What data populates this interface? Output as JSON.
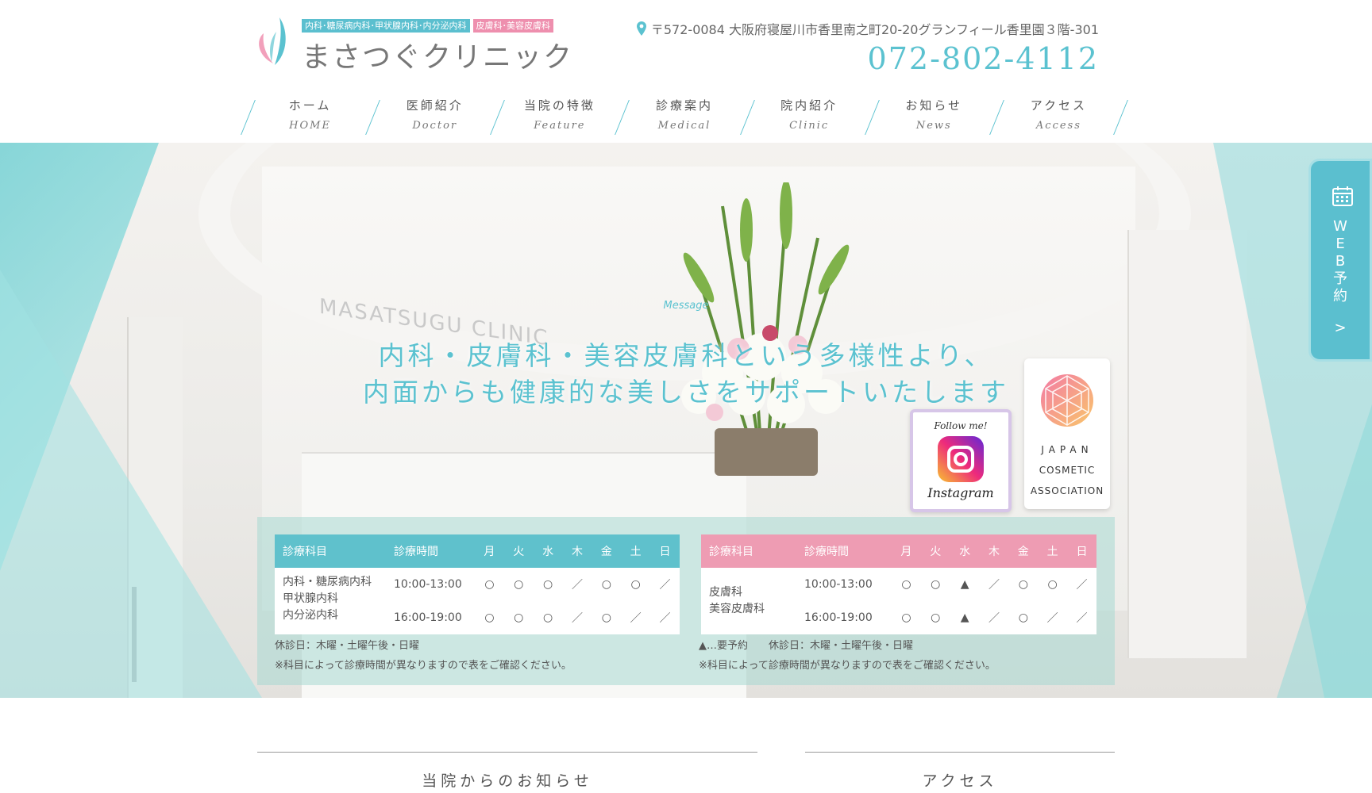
{
  "logo": {
    "tag_internal": "内科･糖尿病内科･甲状腺内科･内分泌内科",
    "tag_derm": "皮膚科･美容皮膚科",
    "name": "まさつぐクリニック"
  },
  "header": {
    "address": "〒572-0084 大阪府寝屋川市香里南之町20-20グランフィール香里園３階-301",
    "phone": "072-802-4112"
  },
  "nav": [
    {
      "jp": "ホーム",
      "en": "HOME"
    },
    {
      "jp": "医師紹介",
      "en": "Doctor"
    },
    {
      "jp": "当院の特徴",
      "en": "Feature"
    },
    {
      "jp": "診療案内",
      "en": "Medical"
    },
    {
      "jp": "院内紹介",
      "en": "Clinic"
    },
    {
      "jp": "お知らせ",
      "en": "News"
    },
    {
      "jp": "アクセス",
      "en": "Access"
    }
  ],
  "hero": {
    "wall_text": "MASATSUGU CLINIC",
    "message_label": "Message",
    "message_line1": "内科・皮膚科・美容皮膚科という多様性より、",
    "message_line2": "内面からも健康的な美しさをサポートいたします"
  },
  "badges": {
    "instagram_follow": "Follow me!",
    "instagram_name": "Instagram",
    "jca_line1": "JAPAN",
    "jca_line2": "COSMETIC",
    "jca_line3": "ASSOCIATION"
  },
  "web_reserve": {
    "label_chars": [
      "W",
      "E",
      "B",
      "予",
      "約"
    ],
    "arrow": ">"
  },
  "schedule_internal": {
    "col_dept": "診療科目",
    "col_time": "診療時間",
    "days": [
      "月",
      "火",
      "水",
      "木",
      "金",
      "土",
      "日"
    ],
    "dept_lines": [
      "内科・糖尿病内科",
      "甲状腺内科",
      "内分泌内科"
    ],
    "rows": [
      {
        "time": "10:00-13:00",
        "marks": [
          "○",
          "○",
          "○",
          "／",
          "○",
          "○",
          "／"
        ]
      },
      {
        "time": "16:00-19:00",
        "marks": [
          "○",
          "○",
          "○",
          "／",
          "○",
          "／",
          "／"
        ]
      }
    ],
    "note1": "休診日：木曜・土曜午後・日曜",
    "note2": "※科目によって診療時間が異なりますので表をご確認ください。"
  },
  "schedule_derm": {
    "col_dept": "診療科目",
    "col_time": "診療時間",
    "days": [
      "月",
      "火",
      "水",
      "木",
      "金",
      "土",
      "日"
    ],
    "dept_lines": [
      "皮膚科",
      "美容皮膚科"
    ],
    "rows": [
      {
        "time": "10:00-13:00",
        "marks": [
          "○",
          "○",
          "▲",
          "／",
          "○",
          "○",
          "／"
        ]
      },
      {
        "time": "16:00-19:00",
        "marks": [
          "○",
          "○",
          "▲",
          "／",
          "○",
          "／",
          "／"
        ]
      }
    ],
    "note1": "▲…要予約　　休診日：木曜・土曜午後・日曜",
    "note2": "※科目によって診療時間が異なりますので表をご確認ください。"
  },
  "sections": {
    "news_title": "当院からのお知らせ",
    "access_title": "アクセス"
  },
  "colors": {
    "teal": "#5bc2d0",
    "pink": "#ee9cb3"
  }
}
